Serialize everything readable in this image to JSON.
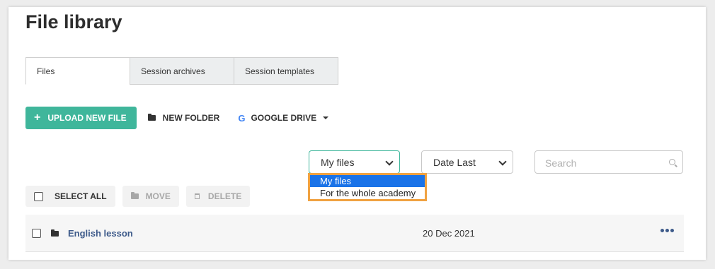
{
  "page": {
    "title": "File library"
  },
  "tabs": [
    {
      "label": "Files",
      "active": true
    },
    {
      "label": "Session archives",
      "active": false
    },
    {
      "label": "Session templates",
      "active": false
    }
  ],
  "toolbar": {
    "upload_label": "UPLOAD NEW FILE",
    "new_folder_label": "NEW FOLDER",
    "google_drive_label": "GOOGLE DRIVE",
    "google_glyph": "G"
  },
  "filters": {
    "owner_select": {
      "value": "My files",
      "options": [
        "My files",
        "For the whole academy"
      ]
    },
    "sort_select": {
      "value": "Date Last"
    },
    "search": {
      "placeholder": "Search",
      "value": ""
    }
  },
  "bulk_actions": {
    "select_all_label": "SELECT ALL",
    "move_label": "MOVE",
    "delete_label": "DELETE"
  },
  "files": [
    {
      "name": "English lesson",
      "date": "20 Dec 2021",
      "type": "folder"
    }
  ],
  "colors": {
    "accent": "#3fb69b",
    "highlight": "#f0a241",
    "link": "#3d5a8a",
    "selection": "#1a73e8"
  }
}
